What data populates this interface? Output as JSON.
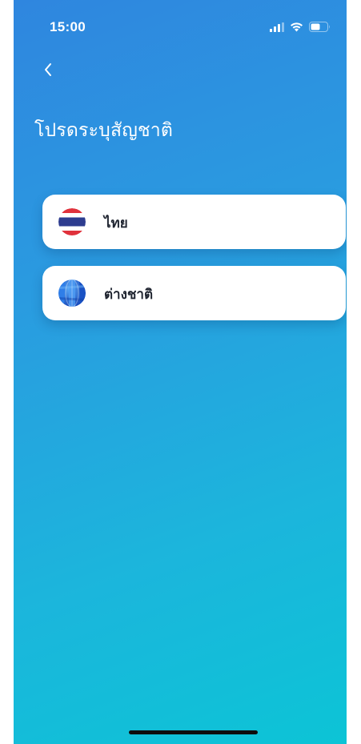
{
  "status_bar": {
    "time": "15:00",
    "icons": [
      "signal-icon",
      "wifi-icon",
      "battery-icon"
    ]
  },
  "header": {
    "back_icon": "chevron-left-icon",
    "title": "โปรดระบุสัญชาติ"
  },
  "options": [
    {
      "label": "ไทย",
      "icon": "thai-flag-icon"
    },
    {
      "label": "ต่างชาติ",
      "icon": "globe-icon"
    }
  ],
  "colors": {
    "background_gradient_start": "#2f86df",
    "background_gradient_end": "#0cc4d6",
    "card_background": "#ffffff",
    "label_text": "#1f2430",
    "thai_flag_red": "#e0323c",
    "thai_flag_blue": "#2d3c8f",
    "globe_blue": "#1f62d6"
  }
}
